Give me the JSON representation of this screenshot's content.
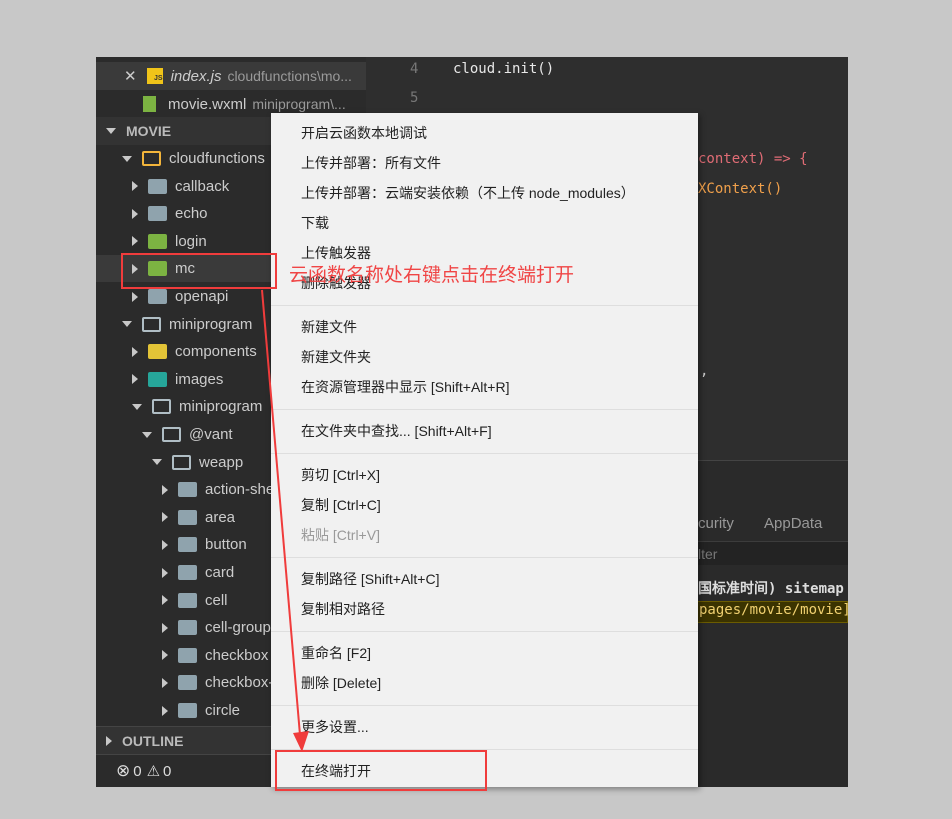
{
  "open_editors": [
    {
      "name": "index.js",
      "path": "cloudfunctions\\mo...",
      "icon": "js-file-icon",
      "active": true
    },
    {
      "name": "movie.wxml",
      "path": "miniprogram\\...",
      "icon": "wxml-file-icon"
    }
  ],
  "explorer": {
    "section": "MOVIE",
    "outline": "OUTLINE",
    "tree": [
      {
        "label": "cloudfunctions",
        "depth": 0,
        "open": true,
        "icon": "openy"
      },
      {
        "label": "callback",
        "depth": 1,
        "icon": ""
      },
      {
        "label": "echo",
        "depth": 1,
        "icon": ""
      },
      {
        "label": "login",
        "depth": 1,
        "icon": "green"
      },
      {
        "label": "mc",
        "depth": 1,
        "icon": "green",
        "selected": true
      },
      {
        "label": "openapi",
        "depth": 1,
        "icon": ""
      },
      {
        "label": "miniprogram",
        "depth": 0,
        "open": true,
        "icon": "open"
      },
      {
        "label": "components",
        "depth": 1,
        "icon": "yellow"
      },
      {
        "label": "images",
        "depth": 1,
        "icon": "teal"
      },
      {
        "label": "miniprogram",
        "depth": 1,
        "open": true,
        "icon": "open"
      },
      {
        "label": "@vant",
        "depth": 2,
        "open": true,
        "icon": "open"
      },
      {
        "label": "weapp",
        "depth": 3,
        "open": true,
        "icon": "open"
      },
      {
        "label": "action-sheet",
        "depth": 4,
        "icon": ""
      },
      {
        "label": "area",
        "depth": 4,
        "icon": ""
      },
      {
        "label": "button",
        "depth": 4,
        "icon": ""
      },
      {
        "label": "card",
        "depth": 4,
        "icon": ""
      },
      {
        "label": "cell",
        "depth": 4,
        "icon": ""
      },
      {
        "label": "cell-group",
        "depth": 4,
        "icon": ""
      },
      {
        "label": "checkbox",
        "depth": 4,
        "icon": ""
      },
      {
        "label": "checkbox-group",
        "depth": 4,
        "icon": ""
      },
      {
        "label": "circle",
        "depth": 4,
        "icon": ""
      }
    ]
  },
  "status": {
    "errors": "0",
    "warnings": "0"
  },
  "editor": {
    "lines": [
      {
        "n": "4",
        "code": "cloud.init()"
      },
      {
        "n": "5",
        "code": ""
      }
    ],
    "frag1": "context) => {",
    "frag2": "XContext()",
    "frag3": ","
  },
  "panel": {
    "tabs": [
      "curity",
      "AppData"
    ],
    "filter": "lter",
    "log1": "国标准时间) sitemap",
    "log2": "pages/movie/movie]"
  },
  "menu": {
    "groups": [
      [
        {
          "label": "开启云函数本地调试"
        },
        {
          "label": "上传并部署：所有文件"
        },
        {
          "label": "上传并部署：云端安装依赖（不上传 node_modules）"
        },
        {
          "label": "下载"
        },
        {
          "label": "上传触发器"
        },
        {
          "label": "删除触发器"
        }
      ],
      [
        {
          "label": "新建文件"
        },
        {
          "label": "新建文件夹"
        },
        {
          "label": "在资源管理器中显示  [Shift+Alt+R]"
        }
      ],
      [
        {
          "label": "在文件夹中查找...  [Shift+Alt+F]"
        }
      ],
      [
        {
          "label": "剪切  [Ctrl+X]"
        },
        {
          "label": "复制  [Ctrl+C]"
        },
        {
          "label": "粘贴  [Ctrl+V]",
          "disabled": true
        }
      ],
      [
        {
          "label": "复制路径  [Shift+Alt+C]"
        },
        {
          "label": "复制相对路径"
        }
      ],
      [
        {
          "label": "重命名  [F2]"
        },
        {
          "label": "删除  [Delete]"
        }
      ],
      [
        {
          "label": "更多设置..."
        }
      ],
      [
        {
          "label": "在终端打开"
        }
      ]
    ]
  },
  "annotation": {
    "text": "云函数名称处右键点击在终端打开",
    "color": "#f03c3c"
  }
}
